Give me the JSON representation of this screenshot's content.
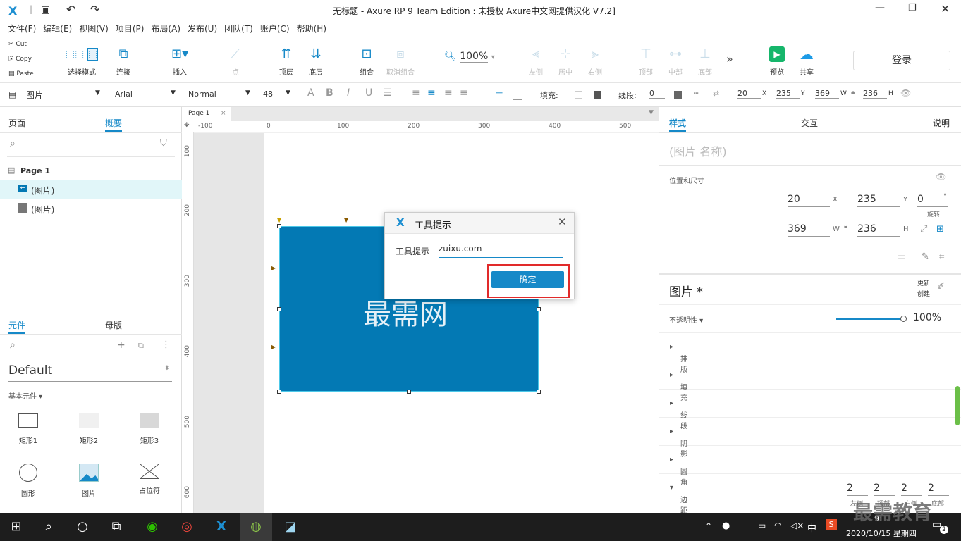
{
  "window": {
    "title": "无标题 - Axure RP 9 Team Edition : 未授权    Axure中文网提供汉化 V7.2]"
  },
  "menu": [
    "文件(F)",
    "编辑(E)",
    "视图(V)",
    "项目(P)",
    "布局(A)",
    "发布(U)",
    "团队(T)",
    "账户(C)",
    "帮助(H)"
  ],
  "clipboard": {
    "cut": "Cut",
    "copy": "Copy",
    "paste": "Paste"
  },
  "toolbar": {
    "select_mode": "选择模式",
    "connect": "连接",
    "insert": "插入",
    "point": "点",
    "top": "顶层",
    "bottom": "底层",
    "group": "组合",
    "ungroup": "取消组合",
    "zoom": "100%",
    "align_left": "左侧",
    "align_center": "居中",
    "align_right": "右侧",
    "align_top": "顶部",
    "align_middle": "中部",
    "align_bottom": "底部",
    "preview": "预览",
    "share": "共享",
    "login": "登录"
  },
  "format": {
    "element_type": "图片",
    "font": "Arial",
    "style": "Normal",
    "size": "48",
    "fill_label": "填充:",
    "stroke_label": "线段:",
    "stroke_value": "0",
    "x": "20",
    "y": "235",
    "w": "369",
    "h": "236",
    "x_l": "X",
    "y_l": "Y",
    "w_l": "W",
    "h_l": "H"
  },
  "left": {
    "tab_pages": "页面",
    "tab_outline": "概要",
    "page_name": "Page 1",
    "outline_items": [
      "(图片)",
      "(图片)"
    ],
    "tab_widgets": "元件",
    "tab_masters": "母版",
    "library": "Default",
    "category": "基本元件",
    "widgets": [
      "矩形1",
      "矩形2",
      "矩形3",
      "圆形",
      "图片",
      "占位符"
    ]
  },
  "canvas": {
    "tab": "Page 1",
    "ruler_x": [
      "-100",
      "0",
      "100",
      "200",
      "300",
      "400",
      "500"
    ],
    "ruler_y": [
      "100",
      "200",
      "300",
      "400",
      "500",
      "600"
    ],
    "image_text": "最需网",
    "image_color": "#0379b4"
  },
  "dialog": {
    "title": "工具提示",
    "label": "工具提示",
    "value": "zuixu.com",
    "ok": "确定"
  },
  "right": {
    "tab_style": "样式",
    "tab_interact": "交互",
    "tab_notes": "说明",
    "name_placeholder": "(图片 名称)",
    "pos_size": "位置和尺寸",
    "x": "20",
    "y": "235",
    "rotate": "0",
    "deg": "°",
    "rotate_label": "旋转",
    "w": "369",
    "h": "236",
    "x_l": "X",
    "y_l": "Y",
    "w_l": "W",
    "h_l": "H",
    "element": "图片 *",
    "update": "更新",
    "create": "创建",
    "opacity_label": "不透明性",
    "opacity": "100%",
    "opacity_fraction": 1.0,
    "rows": [
      "排版",
      "填充",
      "线段",
      "阴影",
      "圆角",
      "边距"
    ],
    "padding": [
      "2",
      "2",
      "2",
      "2"
    ],
    "padding_labels": [
      "左侧",
      "顶部",
      "右侧",
      "底部"
    ]
  },
  "taskbar": {
    "time": "9:",
    "date": "2020/10/15 星期四",
    "ime": "中",
    "notif": "2",
    "watermark": "最需教育"
  },
  "colors": {
    "accent": "#1689c8",
    "highlight": "#e12a2a"
  }
}
